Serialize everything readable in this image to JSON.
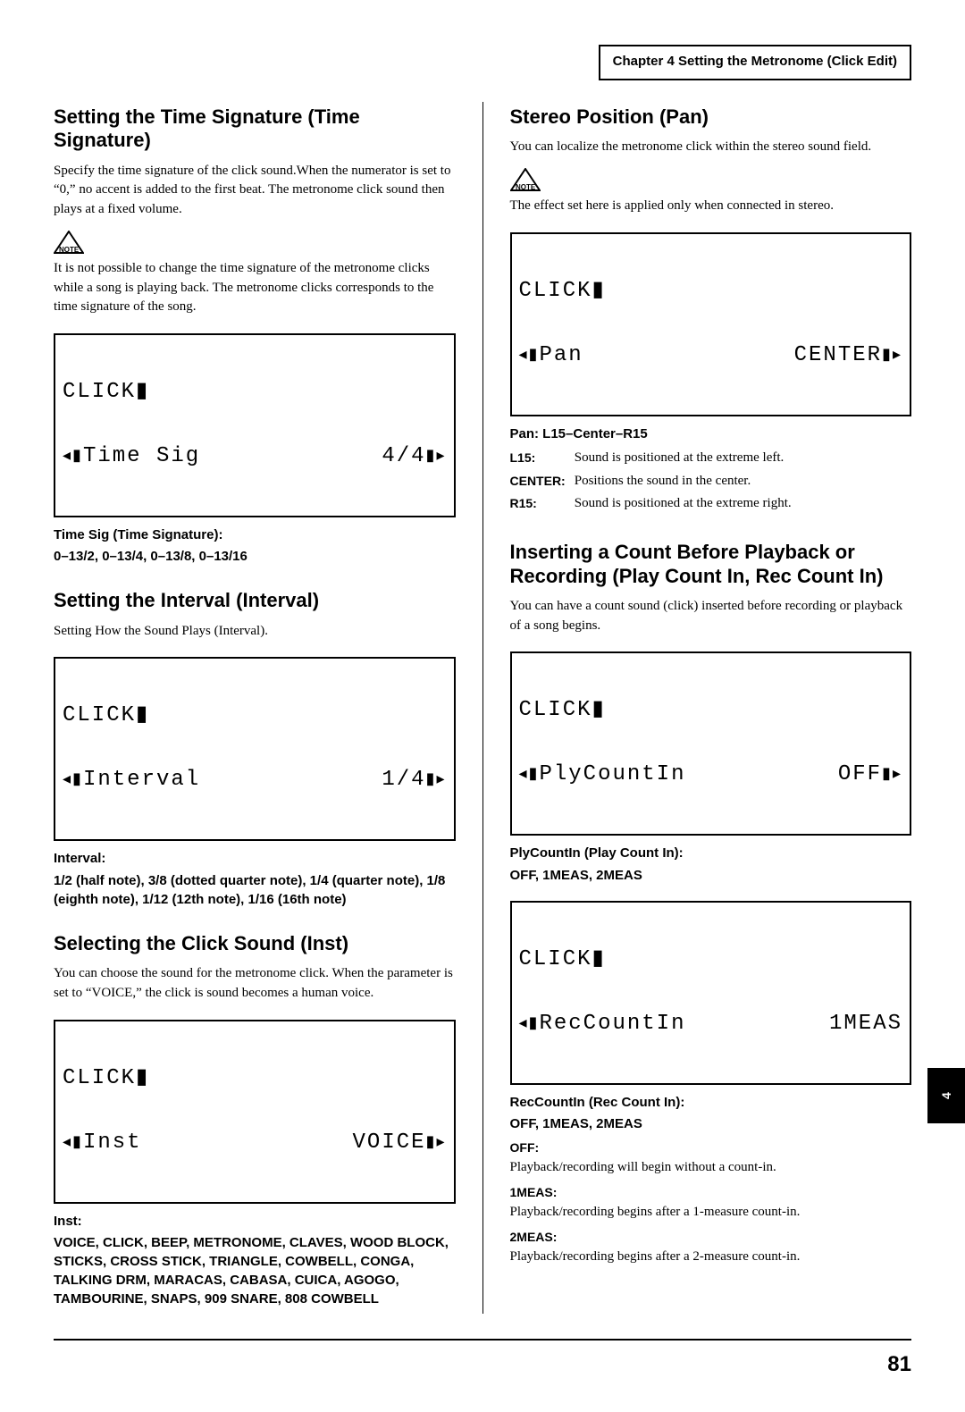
{
  "header": {
    "chapter_label": "Chapter 4 Setting the Metronome (Click Edit)"
  },
  "side_tab": "4",
  "page_number": "81",
  "left": {
    "s1": {
      "heading": "Setting the Time Signature (Time Signature)",
      "body1": "Specify the time signature of the click sound.When the numerator is set to “0,” no accent is added to the first beat. The metronome click sound then plays at a fixed volume.",
      "note": "It is not possible to change the time signature of the metronome clicks while a song is playing back. The metronome clicks corresponds to the time signature of the song.",
      "lcd": {
        "title": "CLICK",
        "param": "Time Sig",
        "value": "4/4"
      },
      "param_title": "Time Sig (Time Signature):",
      "param_values": "0–13/2, 0–13/4, 0–13/8, 0–13/16"
    },
    "s2": {
      "heading": "Setting the Interval (Interval)",
      "body1": "Setting How the Sound Plays (Interval).",
      "lcd": {
        "title": "CLICK",
        "param": "Interval",
        "value": "1/4"
      },
      "param_title": "Interval:",
      "param_values": "1/2 (half note), 3/8 (dotted quarter note), 1/4 (quarter note), 1/8 (eighth note), 1/12 (12th note), 1/16 (16th note)"
    },
    "s3": {
      "heading": "Selecting the Click Sound (Inst)",
      "body1": "You can choose the sound for the metronome click. When the parameter is set to “VOICE,” the click is sound becomes a human voice.",
      "lcd": {
        "title": "CLICK",
        "param": "Inst",
        "value": "VOICE"
      },
      "param_title": "Inst:",
      "param_values": "VOICE, CLICK, BEEP, METRONOME, CLAVES, WOOD BLOCK, STICKS, CROSS STICK, TRIANGLE, COWBELL, CONGA, TALKING DRM, MARACAS, CABASA, CUICA, AGOGO, TAMBOURINE, SNAPS, 909 SNARE, 808 COWBELL"
    }
  },
  "right": {
    "s1": {
      "heading": "Stereo Position (Pan)",
      "body1": "You can localize the metronome click within the stereo sound field.",
      "note": "The effect set here is applied only when connected in stereo.",
      "lcd": {
        "title": "CLICK",
        "param": "Pan",
        "value": "CENTER"
      },
      "param_title": "Pan: L15–Center–R15",
      "table": [
        {
          "k": "L15:",
          "v": "Sound is positioned at the extreme left."
        },
        {
          "k": "CENTER:",
          "v": "Positions the sound in the center."
        },
        {
          "k": "R15:",
          "v": "Sound is positioned at the extreme right."
        }
      ]
    },
    "s2": {
      "heading": "Inserting a Count Before Playback or Recording (Play Count In, Rec Count In)",
      "body1": "You can have a count sound (click) inserted before recording or playback of a song begins.",
      "lcd1": {
        "title": "CLICK",
        "param": "PlyCountIn",
        "value": "OFF"
      },
      "param1_title": "PlyCountIn (Play Count In):",
      "param1_values": "OFF, 1MEAS, 2MEAS",
      "lcd2": {
        "title": "CLICK",
        "param": "RecCountIn",
        "value": "1MEAS"
      },
      "param2_title": "RecCountIn (Rec Count In):",
      "param2_values": "OFF, 1MEAS, 2MEAS",
      "defs": [
        {
          "k": "OFF:",
          "v": "Playback/recording will begin without a count-in."
        },
        {
          "k": "1MEAS:",
          "v": "Playback/recording begins after a 1-measure count-in."
        },
        {
          "k": "2MEAS:",
          "v": "Playback/recording begins after a 2-measure count-in."
        }
      ]
    }
  }
}
